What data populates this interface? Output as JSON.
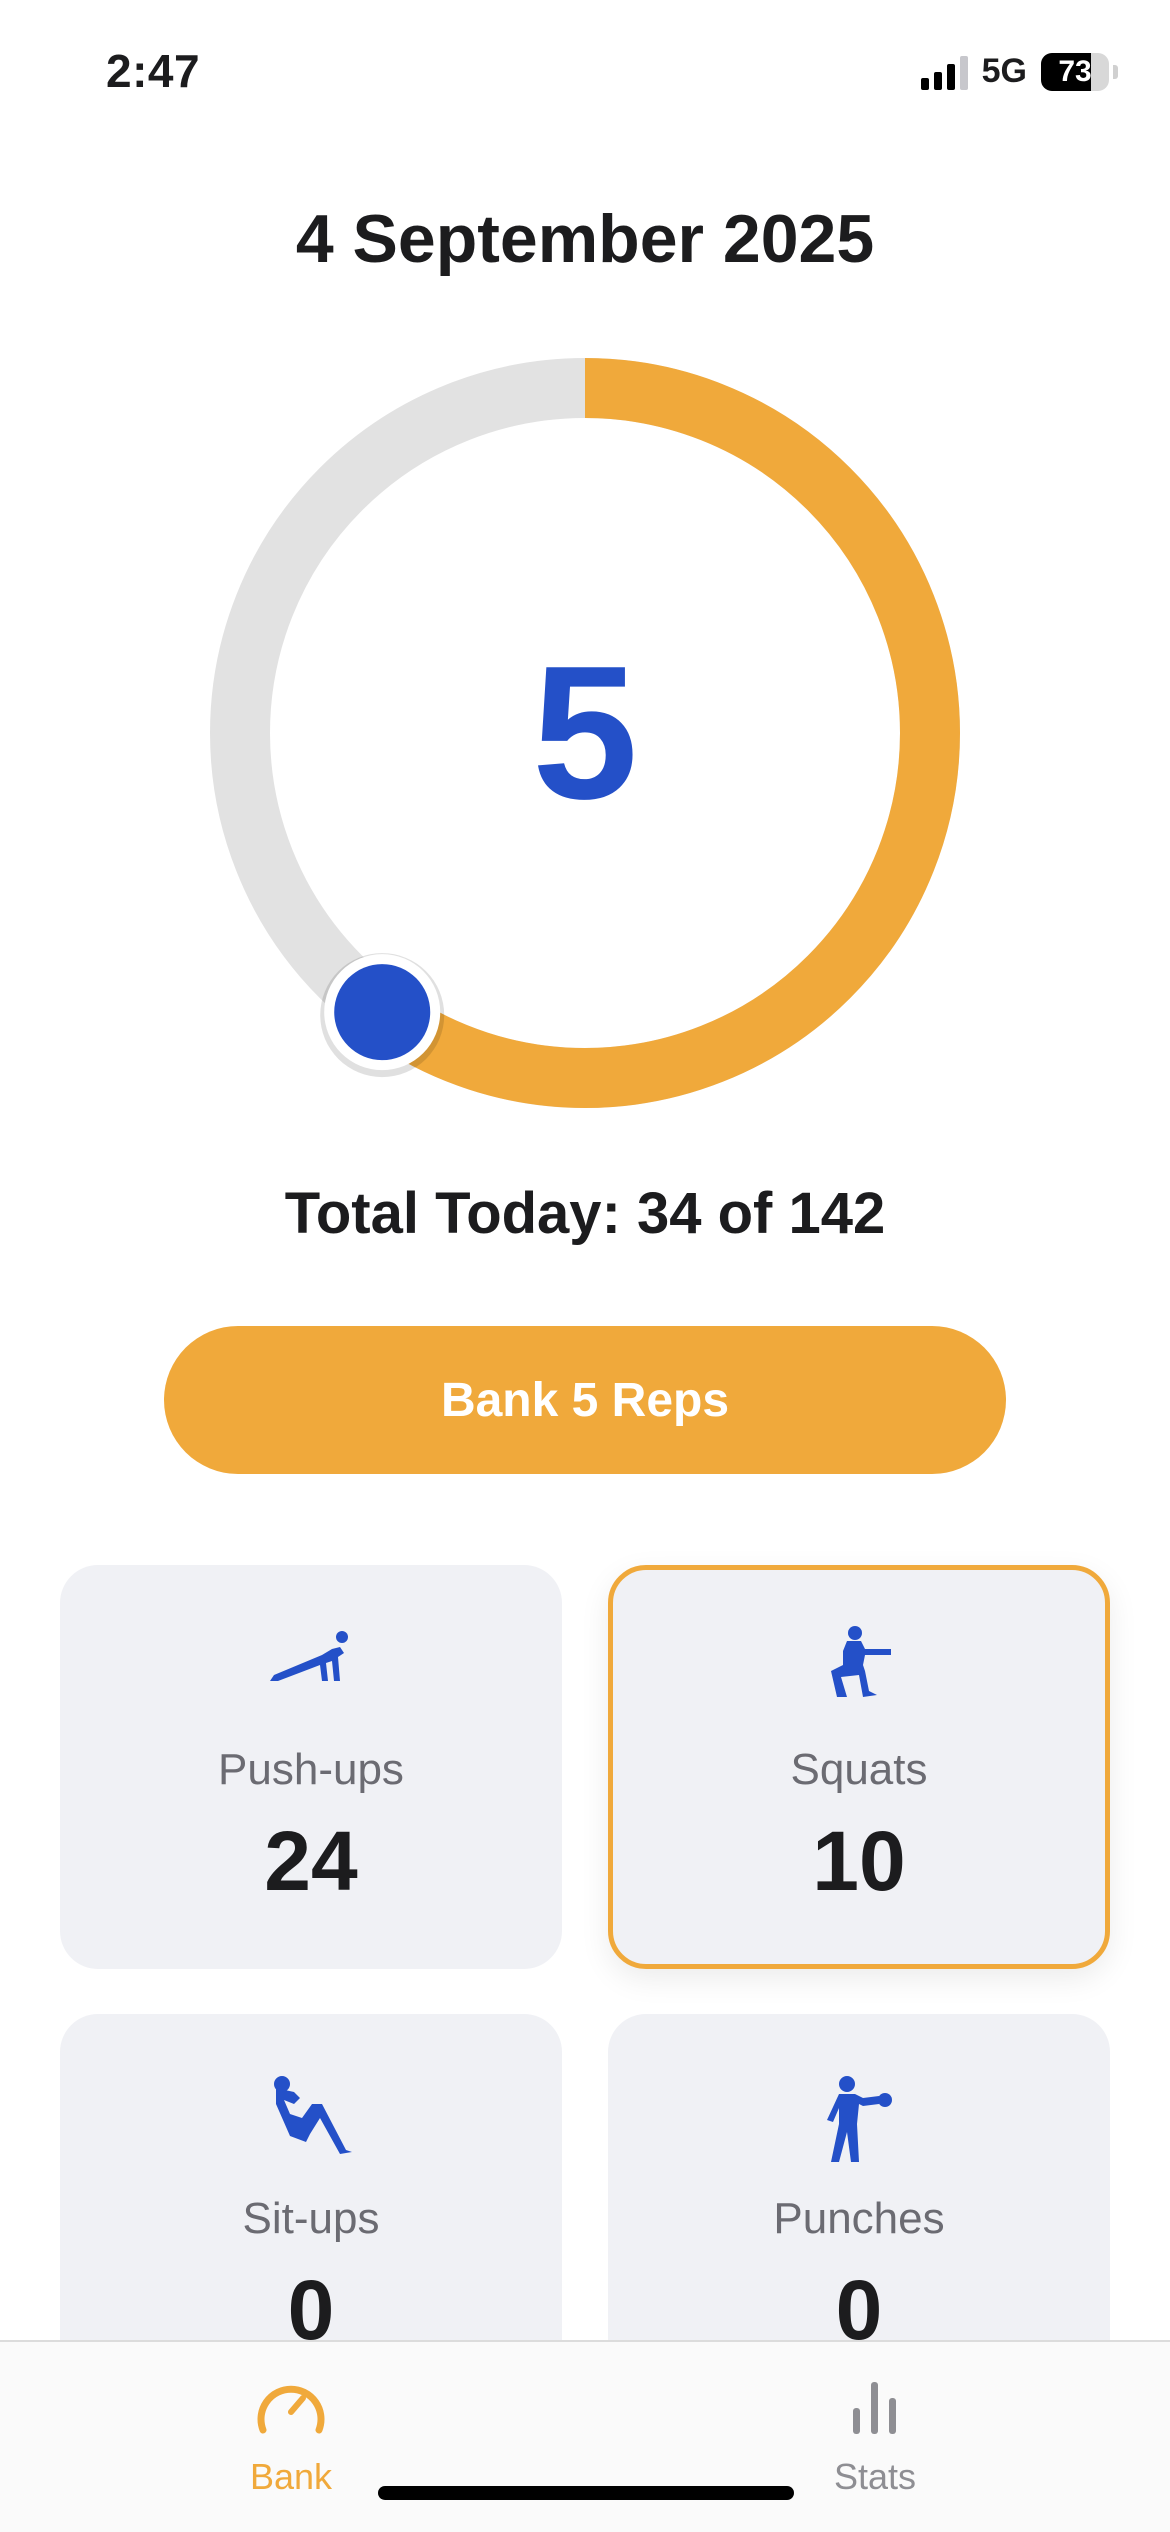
{
  "status_bar": {
    "time": "2:47",
    "network": "5G",
    "battery": "73",
    "battery_level": 0.73
  },
  "header": {
    "date": "4 September 2025"
  },
  "ring": {
    "count": "5",
    "progress_fraction": 0.6,
    "progress_color": "#f0a93b",
    "track_color": "#e2e2e2",
    "knob_color": "#2450c8"
  },
  "summary": {
    "total_text": "Total Today: 34 of 142"
  },
  "bank_button": {
    "label": "Bank 5 Reps"
  },
  "exercises": [
    {
      "label": "Push-ups",
      "count": "24",
      "icon": "push-up-icon",
      "selected": false
    },
    {
      "label": "Squats",
      "count": "10",
      "icon": "squat-icon",
      "selected": true
    },
    {
      "label": "Sit-ups",
      "count": "0",
      "icon": "sit-up-icon",
      "selected": false
    },
    {
      "label": "Punches",
      "count": "0",
      "icon": "punch-icon",
      "selected": false
    }
  ],
  "tab_bar": {
    "tabs": [
      {
        "label": "Bank",
        "icon": "gauge-icon",
        "active": true
      },
      {
        "label": "Stats",
        "icon": "bar-chart-icon",
        "active": false
      }
    ]
  },
  "colors": {
    "accent": "#f0a93b",
    "primary_blue": "#2450c8",
    "card_bg": "#f0f1f5"
  }
}
